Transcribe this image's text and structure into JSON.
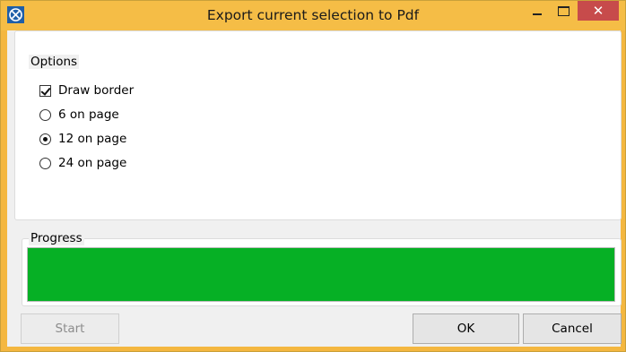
{
  "window": {
    "title": "Export current selection to Pdf",
    "close_glyph": "✕",
    "icon": "app-logo-icon"
  },
  "options": {
    "legend": "Options",
    "draw_border": {
      "label": "Draw border",
      "checked": true
    },
    "radios": [
      {
        "label": "6 on page",
        "checked": false
      },
      {
        "label": "12 on page",
        "checked": true
      },
      {
        "label": "24 on page",
        "checked": false
      }
    ]
  },
  "progress": {
    "legend": "Progress",
    "value": 1.0,
    "color": "#06b025"
  },
  "buttons": {
    "start": "Start",
    "ok": "OK",
    "cancel": "Cancel"
  },
  "colors": {
    "titlebar": "#f5bd46",
    "close": "#c74b4b"
  }
}
